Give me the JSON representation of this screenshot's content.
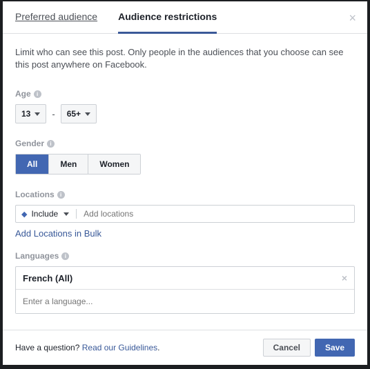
{
  "tabs": {
    "preferred": "Preferred audience",
    "restrictions": "Audience restrictions"
  },
  "description": "Limit who can see this post. Only people in the audiences that you choose can see this post anywhere on Facebook.",
  "age": {
    "label": "Age",
    "min": "13",
    "max": "65+"
  },
  "gender": {
    "label": "Gender",
    "all": "All",
    "men": "Men",
    "women": "Women"
  },
  "locations": {
    "label": "Locations",
    "include": "Include",
    "placeholder": "Add locations",
    "bulk_link": "Add Locations in Bulk"
  },
  "languages": {
    "label": "Languages",
    "selected": "French (All)",
    "placeholder": "Enter a language..."
  },
  "footer": {
    "question": "Have a question? ",
    "guidelines": "Read our Guidelines",
    "period": ".",
    "cancel": "Cancel",
    "save": "Save"
  }
}
